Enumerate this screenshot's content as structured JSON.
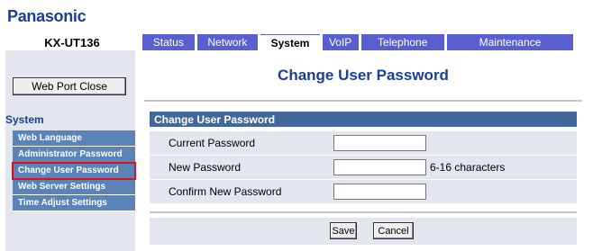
{
  "brand": "Panasonic",
  "model": "KX-UT136",
  "tabs": [
    "Status",
    "Network",
    "System",
    "VoIP",
    "Telephone",
    "Maintenance"
  ],
  "active_tab": "System",
  "sidebar": {
    "port_button": "Web Port Close",
    "section": "System",
    "items": [
      {
        "label": "Web Language"
      },
      {
        "label": "Administrator Password"
      },
      {
        "label": "Change User Password"
      },
      {
        "label": "Web Server Settings"
      },
      {
        "label": "Time Adjust Settings"
      }
    ],
    "selected": "Change User Password"
  },
  "page_title": "Change User Password",
  "panel": {
    "header": "Change User Password",
    "fields": [
      {
        "label": "Current Password",
        "value": ""
      },
      {
        "label": "New Password",
        "value": "",
        "hint": "6-16 characters"
      },
      {
        "label": "Confirm New Password",
        "value": ""
      }
    ]
  },
  "buttons": {
    "save": "Save",
    "cancel": "Cancel"
  },
  "colors": {
    "brand_blue": "#1b3f95",
    "tab_blue": "#5a5fd0",
    "menu_blue": "#5a84b8",
    "panel_header": "#43679a",
    "panel_bg": "#e4e6ee",
    "selection_outline": "#e0101a"
  }
}
